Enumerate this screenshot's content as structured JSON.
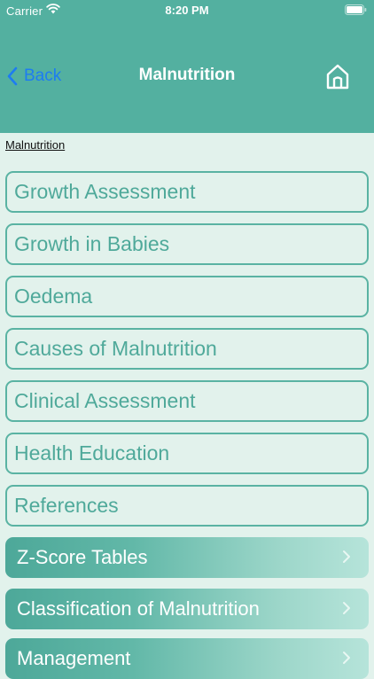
{
  "status_bar": {
    "carrier": "Carrier",
    "time": "8:20 PM"
  },
  "nav": {
    "back_label": "Back",
    "title": "Malnutrition"
  },
  "breadcrumb": "Malnutrition",
  "menu_items": [
    "Growth Assessment",
    "Growth in Babies",
    "Oedema",
    "Causes of Malnutrition",
    "Clinical Assessment",
    "Health Education",
    "References"
  ],
  "section_items": [
    "Z-Score Tables",
    "Classification of Malnutrition",
    "Management"
  ],
  "colors": {
    "header": "#53b0a0",
    "background": "#e2f2ec",
    "accent": "#4fa99a",
    "back_link": "#1d7cf2"
  }
}
